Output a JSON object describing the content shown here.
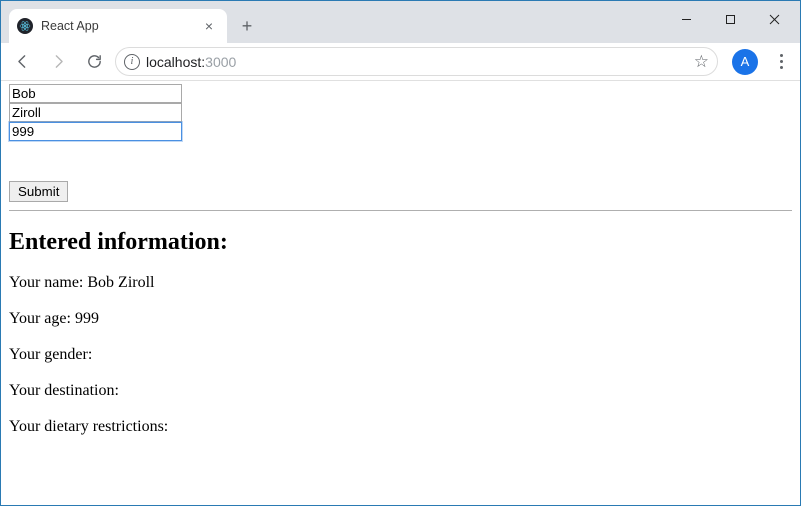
{
  "browser": {
    "tab_title": "React App",
    "url_host": "localhost:",
    "url_port": "3000",
    "avatar_letter": "A"
  },
  "form": {
    "first_name": "Bob",
    "last_name": "Ziroll",
    "age": "999",
    "submit_label": "Submit"
  },
  "output": {
    "heading": "Entered information:",
    "name_label": "Your name: ",
    "name_value": "Bob Ziroll",
    "age_label": "Your age: ",
    "age_value": "999",
    "gender_label": "Your gender:",
    "gender_value": "",
    "destination_label": "Your destination:",
    "destination_value": "",
    "diet_label": "Your dietary restrictions:",
    "diet_value": ""
  }
}
